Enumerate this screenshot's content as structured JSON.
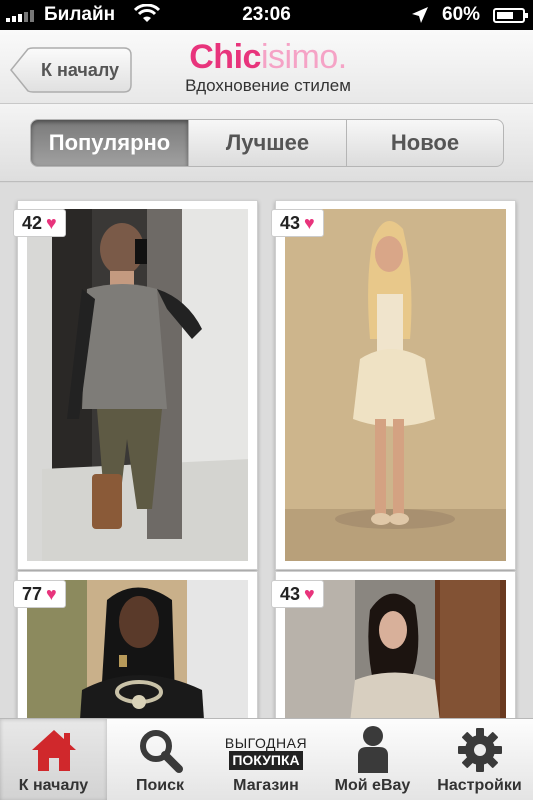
{
  "status_bar": {
    "carrier": "Билайн",
    "time": "23:06",
    "battery": "60%",
    "battery_level": 0.6,
    "icons": [
      "signal-icon",
      "wifi-icon",
      "location-arrow-icon",
      "battery-icon"
    ]
  },
  "header": {
    "back_label": "К началу",
    "brand_part1": "Chic",
    "brand_part2": "isimo.",
    "tagline": "Вдохновение стилем",
    "colors": {
      "brand_pink": "#e8347c",
      "brand_light_pink": "#f5a3c6"
    }
  },
  "tabs_segment": {
    "items": [
      {
        "label": "Популярно",
        "selected": true
      },
      {
        "label": "Лучшее",
        "selected": false
      },
      {
        "label": "Новое",
        "selected": false
      }
    ]
  },
  "feed": {
    "cards": [
      {
        "likes": "42",
        "image": "woman taking mirror selfie in grey top and camo pants"
      },
      {
        "likes": "43",
        "image": "blonde woman in cream feathered mini dress"
      },
      {
        "likes": "77",
        "image": "woman in black top with statement necklace"
      },
      {
        "likes": "43",
        "image": "woman with dark hair in cream knit sweater"
      }
    ],
    "heart_icon": "heart-icon"
  },
  "tab_bar": {
    "items": [
      {
        "label": "К началу",
        "icon": "home-icon",
        "active": true
      },
      {
        "label": "Поиск",
        "icon": "search-icon",
        "active": false
      },
      {
        "label": "Магазин",
        "icon": "ebay-deal-icon",
        "active": false,
        "icon_text_top": "ВЫГОДНАЯ",
        "icon_text_bottom": "ПОКУПКА"
      },
      {
        "label": "Мой eBay",
        "icon": "person-icon",
        "active": false
      },
      {
        "label": "Настройки",
        "icon": "gear-icon",
        "active": false
      }
    ],
    "colors": {
      "home_red": "#d0282c"
    }
  }
}
